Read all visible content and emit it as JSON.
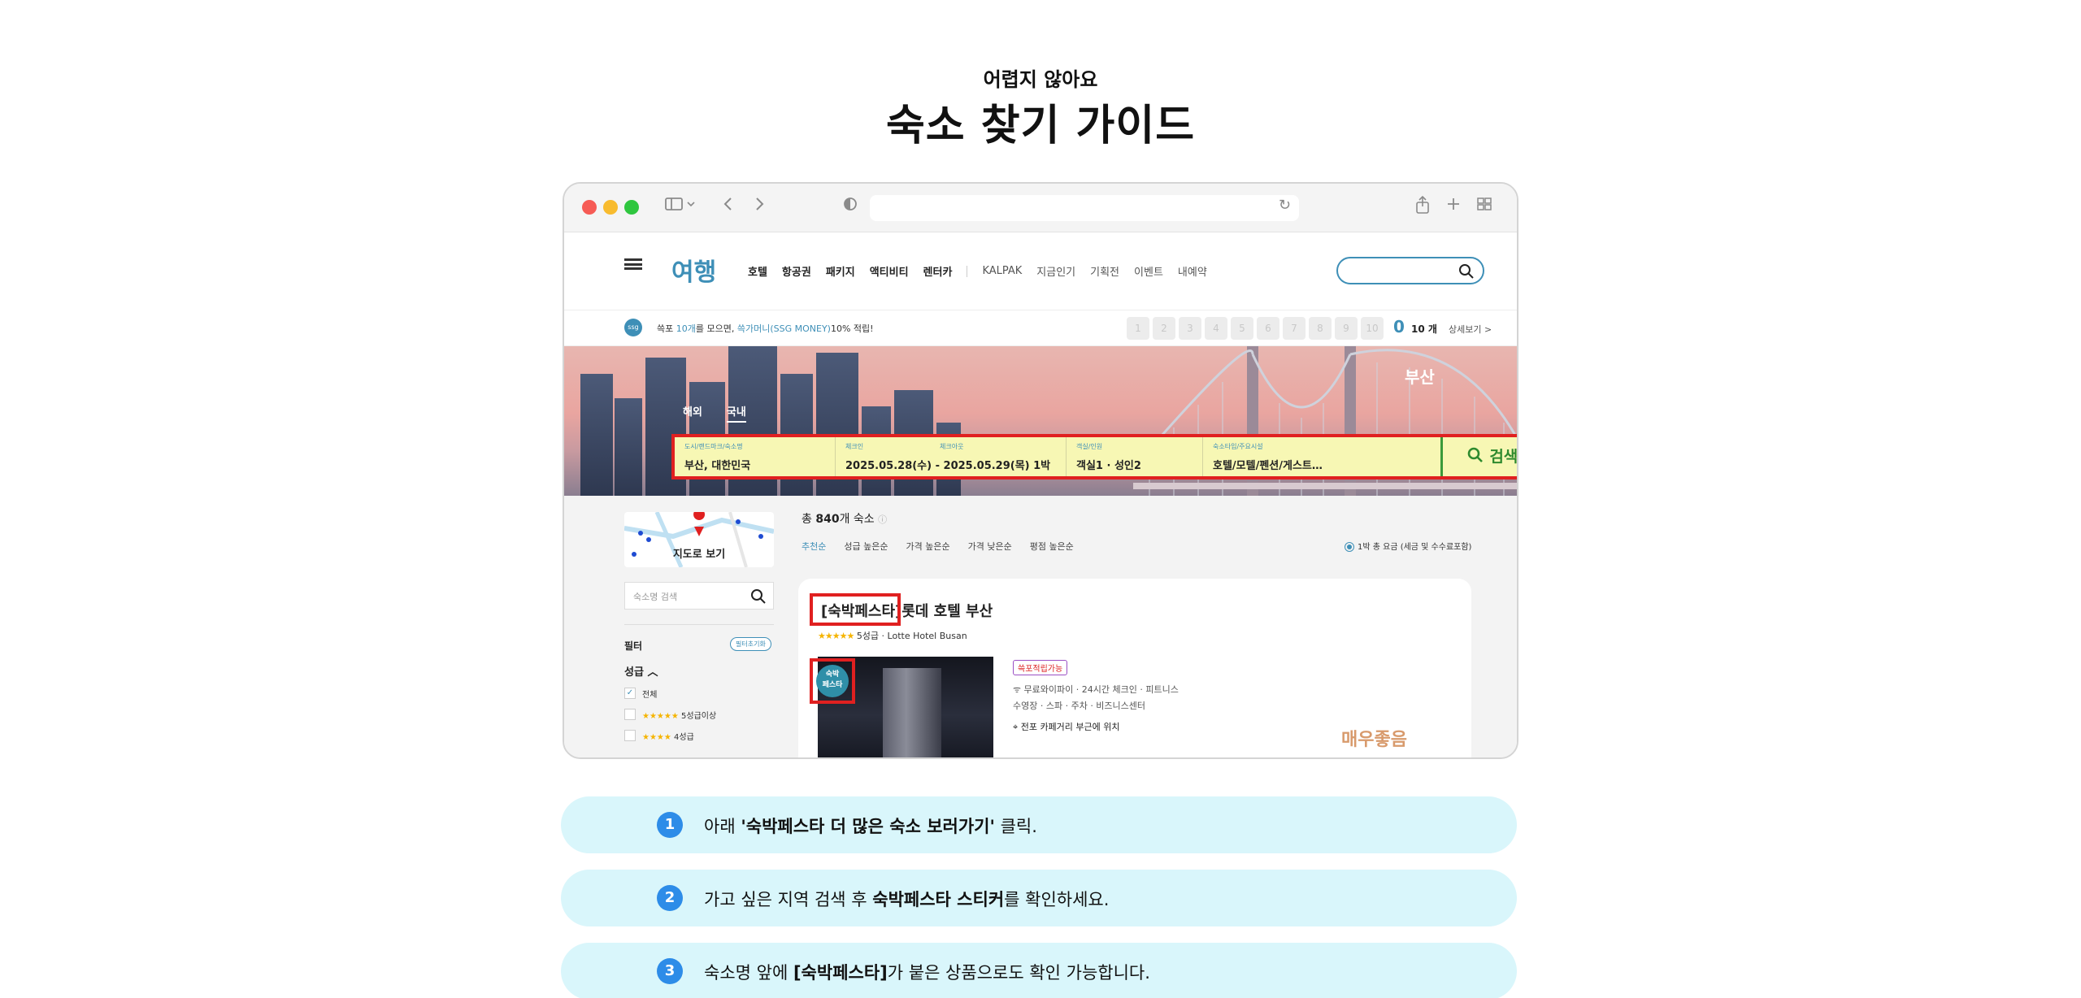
{
  "heading": {
    "eyebrow": "어렵지 않아요",
    "title": "숙소 찾기 가이드"
  },
  "site": {
    "logo": "여행",
    "nav_primary": [
      "호텔",
      "항공권",
      "패키지",
      "액티비티",
      "렌터카"
    ],
    "nav_secondary": [
      "KALPAK",
      "지금인기",
      "기획전",
      "이벤트",
      "내예약"
    ]
  },
  "points": {
    "text_a": "쓱포 ",
    "text_b": "10개",
    "text_c": "를 모으면, ",
    "text_d": "쓱가머니(SSG MONEY)",
    "text_e": "10% 적립!",
    "stamps": [
      "1",
      "2",
      "3",
      "4",
      "5",
      "6",
      "7",
      "8",
      "9",
      "10"
    ],
    "count": "0",
    "unit": "10 개",
    "more": "상세보기 >"
  },
  "hero": {
    "city": "부산",
    "tabs": [
      "해외",
      "국내"
    ],
    "search": {
      "destination_label": "도시/랜드마크/숙소명",
      "destination_value": "부산, 대한민국",
      "checkin_label": "체크인",
      "checkout_label": "체크아웃",
      "dates_value": "2025.05.28(수)  -   2025.05.29(목)   1박",
      "guests_label": "객실/인원",
      "guests_value": "객실1 · 성인2",
      "type_label": "숙소타입/주요시설",
      "type_value": "호텔/모텔/펜션/게스트…",
      "button": "검색"
    }
  },
  "sidebar": {
    "map_label": "지도로 보기",
    "name_search_placeholder": "숙소명 검색",
    "filter_title": "필터",
    "filter_reset": "필터초기화",
    "grade_title": "성급",
    "grade_options": [
      {
        "stars": "",
        "label": "전체",
        "checked": "✓"
      },
      {
        "stars": "★★★★★",
        "label": "5성급이상",
        "checked": ""
      },
      {
        "stars": "★★★★",
        "label": "4성급",
        "checked": ""
      }
    ]
  },
  "results": {
    "total_prefix": "총 ",
    "total_count": "840",
    "total_suffix": "개 숙소",
    "sorts": [
      "추천순",
      "성급 높은순",
      "가격 높은순",
      "가격 낮은순",
      "평점 높은순"
    ],
    "price_option": "1박 총 요금 (세금 및 수수료포함)",
    "card": {
      "name": "[숙박페스타]롯데 호텔 부산",
      "stars": "★★★★★",
      "grade": "5성급 · Lotte Hotel Busan",
      "sticker": "숙박\n페스타",
      "point_tag": "쓱포적립가능",
      "amenities_1": "무료와이파이 · 24시간 체크인 · 피트니스",
      "amenities_2": "수영장 · 스파 · 주차 · 비즈니스센터",
      "location": "전포 카페거리 부근에 위치",
      "review": "매우좋음"
    }
  },
  "steps": [
    {
      "num": "1",
      "before": "아래 ",
      "bold": "'숙박페스타 더 많은 숙소 보러가기'",
      "after": " 클릭."
    },
    {
      "num": "2",
      "before": "가고 싶은 지역 검색 후 ",
      "bold": "숙박페스타 스티커",
      "after": "를 확인하세요."
    },
    {
      "num": "3",
      "before": "숙소명 앞에 ",
      "bold": "[숙박페스타]",
      "after": "가 붙은 상품으로도 확인 가능합니다."
    }
  ],
  "icons": [
    "sidebar-icon",
    "back-icon",
    "forward-icon",
    "shield-icon",
    "reload-icon",
    "share-icon",
    "plus-icon",
    "tabs-icon",
    "search-icon",
    "map-pin-icon",
    "wifi-icon",
    "location-icon"
  ]
}
